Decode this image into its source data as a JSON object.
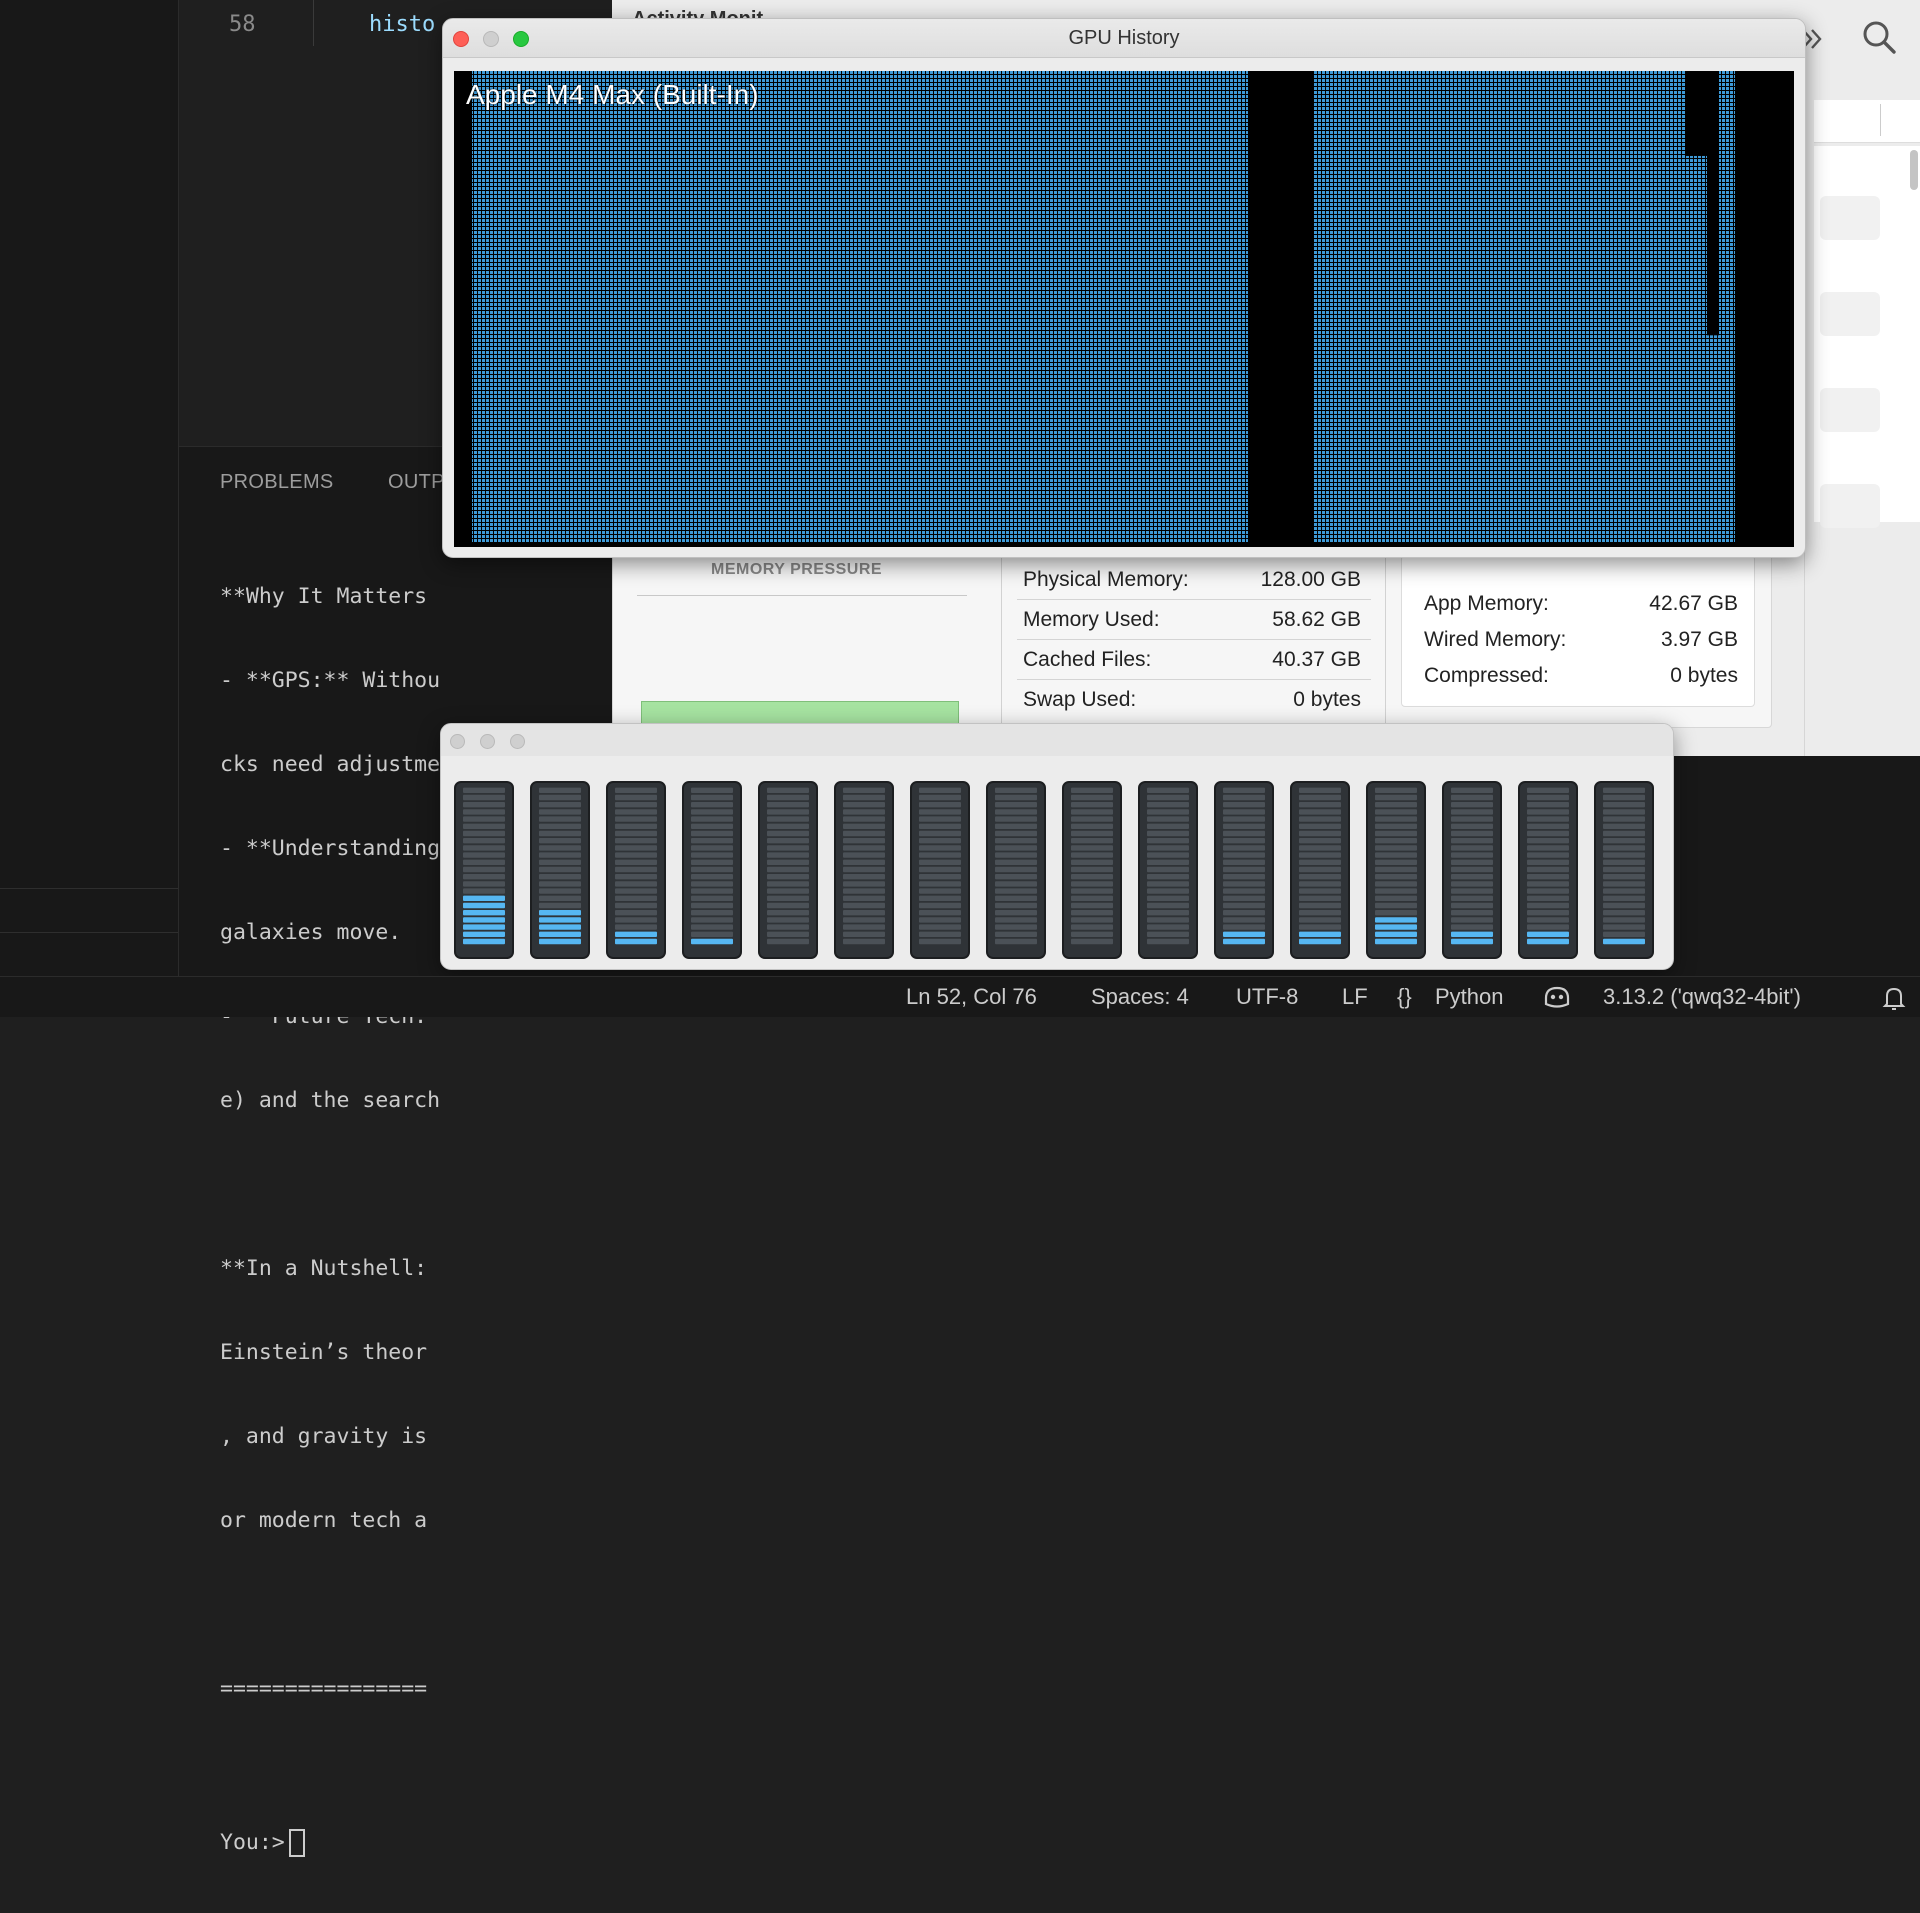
{
  "editor": {
    "line_number": "58",
    "code_fragment": "histo",
    "panel_tabs": [
      "PROBLEMS",
      "OUTP"
    ]
  },
  "terminal": {
    "lines": [
      "**Why It Matters",
      "- **GPS:** Withou",
      "cks need adjustme",
      "- **Understanding",
      "galaxies move.",
      "- **Future Tech:*",
      "e) and the search",
      "",
      "**In a Nutshell:",
      "Einstein’s theor",
      ", and gravity is",
      "or modern tech a",
      "",
      "================",
      ""
    ],
    "prompt": "You:>"
  },
  "activity_monitor": {
    "title": "Activity Monit",
    "memory_pressure_label": "MEMORY PRESSURE",
    "physical_memory": {
      "label": "Physical Memory:",
      "value": "128.00 GB"
    },
    "memory_used": {
      "label": "Memory Used:",
      "value": "58.62 GB"
    },
    "cached_files": {
      "label": "Cached Files:",
      "value": "40.37 GB"
    },
    "swap_used": {
      "label": "Swap Used:",
      "value": "0 bytes"
    },
    "app_memory": {
      "label": "App Memory:",
      "value": "42.67 GB"
    },
    "wired_memory": {
      "label": "Wired Memory:",
      "value": "3.97 GB"
    },
    "compressed": {
      "label": "Compressed:",
      "value": "0 bytes"
    }
  },
  "gpu_window": {
    "title": "GPU History",
    "gpu_name": "Apple M4 Max (Built-In)",
    "bar_color": "#3d9ad8",
    "usage_history_fraction": {
      "segment_1": 1.0,
      "idle_gap": 0.0,
      "segment_2": 1.0,
      "tail_step_1": 0.82,
      "tail_step_2": 0.44,
      "tail_step_3": 1.0
    }
  },
  "cpu_window": {
    "core_count": 16,
    "core_load_fraction": [
      0.33,
      0.22,
      0.11,
      0.06,
      0.0,
      0.0,
      0.0,
      0.0,
      0.0,
      0.0,
      0.11,
      0.11,
      0.17,
      0.11,
      0.11,
      0.06
    ],
    "active_color": "#56b7f2",
    "inactive_color": "#4b5157"
  },
  "status_bar": {
    "position": "Ln 52, Col 76",
    "spaces": "Spaces: 4",
    "encoding": "UTF-8",
    "eol": "LF",
    "language_braces": "{}",
    "language": "Python",
    "interpreter": "3.13.2 ('qwq32-4bit')"
  },
  "icons": [
    "forward-chevrons-icon",
    "search-icon",
    "copilot-icon",
    "bell-icon"
  ]
}
